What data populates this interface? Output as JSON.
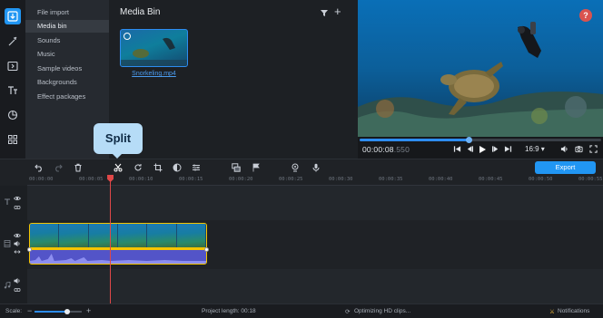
{
  "sidebar": {
    "categories": [
      {
        "label": "File import",
        "active": false
      },
      {
        "label": "Media bin",
        "active": true
      },
      {
        "label": "Sounds",
        "active": false
      },
      {
        "label": "Music",
        "active": false
      },
      {
        "label": "Sample videos",
        "active": false
      },
      {
        "label": "Backgrounds",
        "active": false
      },
      {
        "label": "Effect packages",
        "active": false
      }
    ],
    "rail_icons": [
      "import-icon",
      "magic-wand-icon",
      "transition-icon",
      "titles-icon",
      "sticker-icon",
      "more-tools-icon"
    ]
  },
  "media_bin": {
    "title": "Media Bin",
    "items": [
      {
        "filename": "Snorkeling.mp4"
      }
    ]
  },
  "preview": {
    "help_label": "?",
    "timecode_current": "00:00:08",
    "timecode_total": ".550",
    "progress": 0.45,
    "aspect_ratio": "16:9 ▾"
  },
  "toolbar": {
    "tooltip": "Split",
    "export_label": "Export"
  },
  "timeline": {
    "ruler_ticks": [
      "00:00:00",
      "00:00:05",
      "00:00:10",
      "00:00:15",
      "00:00:20",
      "00:00:25",
      "00:00:30",
      "00:00:35",
      "00:00:40",
      "00:00:45",
      "00:00:50",
      "00:00:55"
    ],
    "playhead_seconds": 8.55
  },
  "status": {
    "scale_label": "Scale:",
    "scale_level": 0.7,
    "project_length": "Project length:  00:18",
    "optimizing": "Optimizing HD clips...",
    "notifications": "Notifications"
  },
  "colors": {
    "accent": "#2196f3",
    "clip_border": "#f5c400",
    "playhead": "#e04848",
    "tooltip_bg": "#b6dcf7"
  }
}
